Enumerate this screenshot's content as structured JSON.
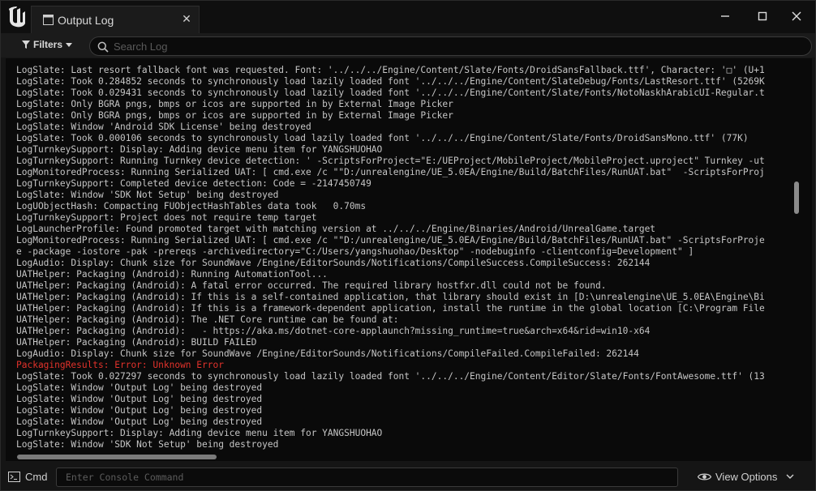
{
  "tab": {
    "title": "Output Log",
    "close_glyph": "✕"
  },
  "toolbar": {
    "filters_label": "Filters",
    "search_placeholder": "Search Log"
  },
  "log": {
    "lines": [
      {
        "text": "LogSlate: Last resort fallback font was requested. Font: '../../../Engine/Content/Slate/Fonts/DroidSansFallback.ttf', Character: '□' (U+1",
        "level": "normal"
      },
      {
        "text": "LogSlate: Took 0.284852 seconds to synchronously load lazily loaded font '../../../Engine/Content/SlateDebug/Fonts/LastResort.ttf' (5269K",
        "level": "normal"
      },
      {
        "text": "LogSlate: Took 0.029431 seconds to synchronously load lazily loaded font '../../../Engine/Content/Slate/Fonts/NotoNaskhArabicUI-Regular.t",
        "level": "normal"
      },
      {
        "text": "LogSlate: Only BGRA pngs, bmps or icos are supported in by External Image Picker",
        "level": "normal"
      },
      {
        "text": "LogSlate: Only BGRA pngs, bmps or icos are supported in by External Image Picker",
        "level": "normal"
      },
      {
        "text": "LogSlate: Window 'Android SDK License' being destroyed",
        "level": "normal"
      },
      {
        "text": "LogSlate: Took 0.000106 seconds to synchronously load lazily loaded font '../../../Engine/Content/Slate/Fonts/DroidSansMono.ttf' (77K)",
        "level": "normal"
      },
      {
        "text": "LogTurnkeySupport: Display: Adding device menu item for YANGSHUOHAO",
        "level": "normal"
      },
      {
        "text": "LogTurnkeySupport: Running Turnkey device detection: ' -ScriptsForProject=\"E:/UEProject/MobileProject/MobileProject.uproject\" Turnkey -ut",
        "level": "normal"
      },
      {
        "text": "LogMonitoredProcess: Running Serialized UAT: [ cmd.exe /c \"\"D:/unrealengine/UE_5.0EA/Engine/Build/BatchFiles/RunUAT.bat\"  -ScriptsForProj",
        "level": "normal"
      },
      {
        "text": "LogTurnkeySupport: Completed device detection: Code = -2147450749",
        "level": "normal"
      },
      {
        "text": "LogSlate: Window 'SDK Not Setup' being destroyed",
        "level": "normal"
      },
      {
        "text": "LogUObjectHash: Compacting FUObjectHashTables data took   0.70ms",
        "level": "normal"
      },
      {
        "text": "LogTurnkeySupport: Project does not require temp target",
        "level": "normal"
      },
      {
        "text": "LogLauncherProfile: Found promoted target with matching version at ../../../Engine/Binaries/Android/UnrealGame.target",
        "level": "normal"
      },
      {
        "text": "LogMonitoredProcess: Running Serialized UAT: [ cmd.exe /c \"\"D:/unrealengine/UE_5.0EA/Engine/Build/BatchFiles/RunUAT.bat\" -ScriptsForProje",
        "level": "normal"
      },
      {
        "text": "e -package -iostore -pak -prereqs -archivedirectory=\"C:/Users/yangshuohao/Desktop\" -nodebuginfo -clientconfig=Development\" ]",
        "level": "normal"
      },
      {
        "text": "LogAudio: Display: Chunk size for SoundWave /Engine/EditorSounds/Notifications/CompileSuccess.CompileSuccess: 262144",
        "level": "normal"
      },
      {
        "text": "UATHelper: Packaging (Android): Running AutomationTool...",
        "level": "normal"
      },
      {
        "text": "UATHelper: Packaging (Android): A fatal error occurred. The required library hostfxr.dll could not be found.",
        "level": "normal"
      },
      {
        "text": "UATHelper: Packaging (Android): If this is a self-contained application, that library should exist in [D:\\unrealengine\\UE_5.0EA\\Engine\\Bi",
        "level": "normal"
      },
      {
        "text": "UATHelper: Packaging (Android): If this is a framework-dependent application, install the runtime in the global location [C:\\Program File",
        "level": "normal"
      },
      {
        "text": "UATHelper: Packaging (Android): The .NET Core runtime can be found at:",
        "level": "normal"
      },
      {
        "text": "UATHelper: Packaging (Android):   - https://aka.ms/dotnet-core-applaunch?missing_runtime=true&arch=x64&rid=win10-x64",
        "level": "normal"
      },
      {
        "text": "UATHelper: Packaging (Android): BUILD FAILED",
        "level": "normal"
      },
      {
        "text": "LogAudio: Display: Chunk size for SoundWave /Engine/EditorSounds/Notifications/CompileFailed.CompileFailed: 262144",
        "level": "normal"
      },
      {
        "text": "PackagingResults: Error: Unknown Error",
        "level": "error"
      },
      {
        "text": "LogSlate: Took 0.027297 seconds to synchronously load lazily loaded font '../../../Engine/Content/Editor/Slate/Fonts/FontAwesome.ttf' (13",
        "level": "normal"
      },
      {
        "text": "LogSlate: Window 'Output Log' being destroyed",
        "level": "normal"
      },
      {
        "text": "LogSlate: Window 'Output Log' being destroyed",
        "level": "normal"
      },
      {
        "text": "LogSlate: Window 'Output Log' being destroyed",
        "level": "normal"
      },
      {
        "text": "LogSlate: Window 'Output Log' being destroyed",
        "level": "normal"
      },
      {
        "text": "LogTurnkeySupport: Display: Adding device menu item for YANGSHUOHAO",
        "level": "normal"
      },
      {
        "text": "LogSlate: Window 'SDK Not Setup' being destroyed",
        "level": "normal"
      }
    ]
  },
  "bottom": {
    "cmd_label": "Cmd",
    "console_placeholder": "Enter Console Command",
    "view_options_label": "View Options"
  },
  "colors": {
    "error": "#e2322b",
    "log_text": "#c6c6c6",
    "background": "#0a0a0a"
  },
  "icons": [
    "unreal-logo-icon",
    "output-log-icon",
    "close-icon",
    "minimize-icon",
    "maximize-icon",
    "filter-icon",
    "search-icon",
    "terminal-icon",
    "eye-icon",
    "chevron-down-icon"
  ]
}
